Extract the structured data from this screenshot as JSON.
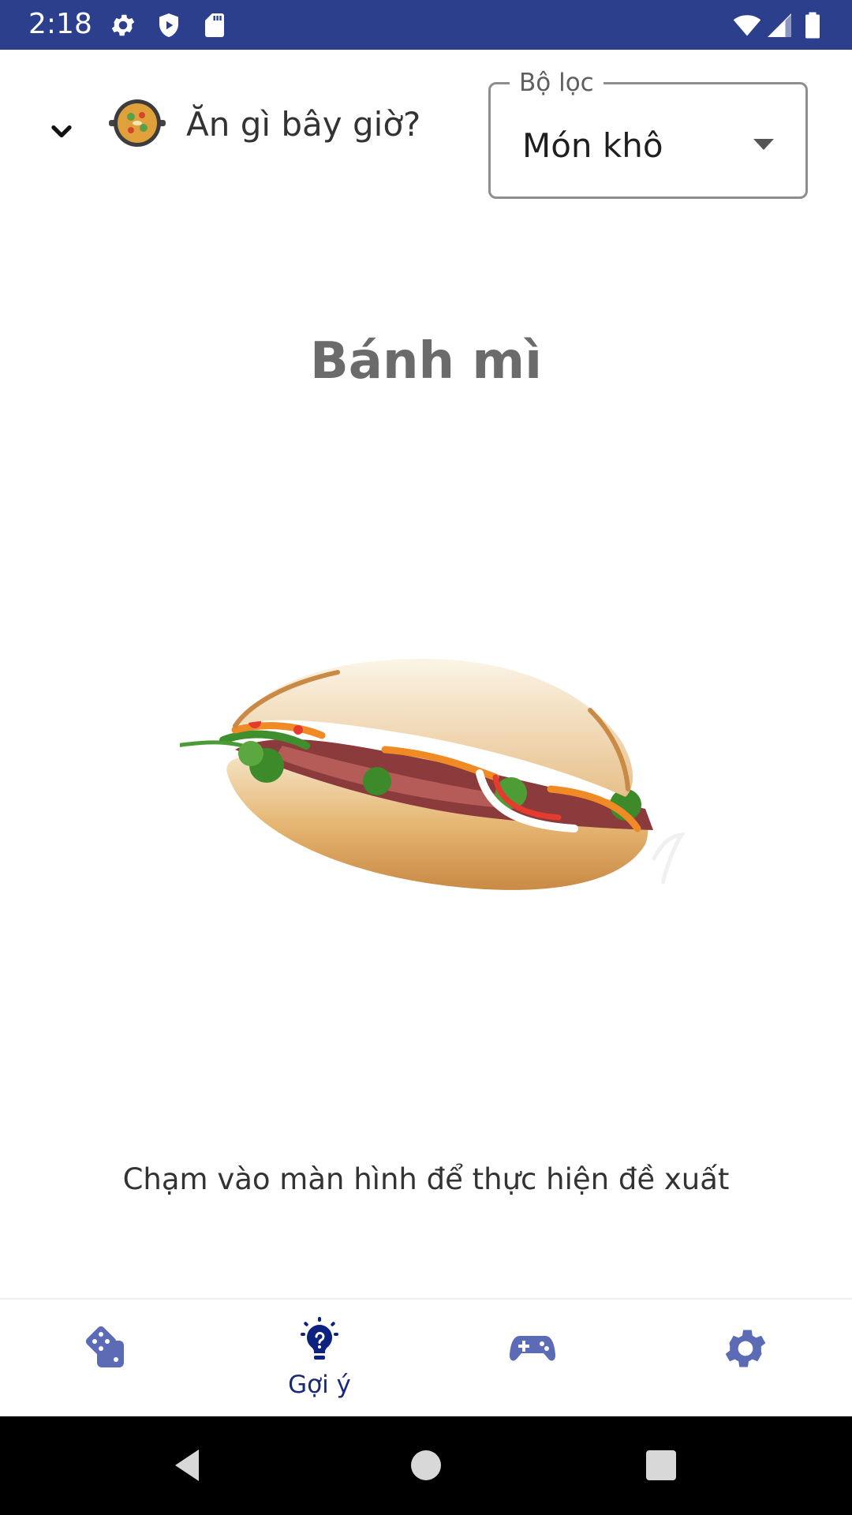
{
  "status_bar": {
    "time": "2:18",
    "icons": [
      "settings-icon",
      "shield-icon",
      "sd-card-icon",
      "wifi-icon",
      "signal-icon",
      "battery-icon"
    ],
    "background": "#2b3f8c"
  },
  "header": {
    "app_title": "Ăn gì bây giờ?",
    "filter": {
      "label": "Bộ lọc",
      "selected_value": "Món khô"
    }
  },
  "main": {
    "dish_name": "Bánh mì",
    "dish_image": "banh-mi-sandwich",
    "hint": "Chạm vào màn hình để thực hiện đề xuất"
  },
  "bottom_nav": {
    "items": [
      {
        "icon": "dice-icon",
        "label": ""
      },
      {
        "icon": "lightbulb-icon",
        "label": "Gợi ý",
        "active": true
      },
      {
        "icon": "gamepad-icon",
        "label": ""
      },
      {
        "icon": "gear-icon",
        "label": ""
      }
    ],
    "accent_color": "#0d2180",
    "inactive_color": "#5b6bb5"
  },
  "system_nav": {
    "buttons": [
      "back-icon",
      "home-icon",
      "recents-icon"
    ]
  }
}
